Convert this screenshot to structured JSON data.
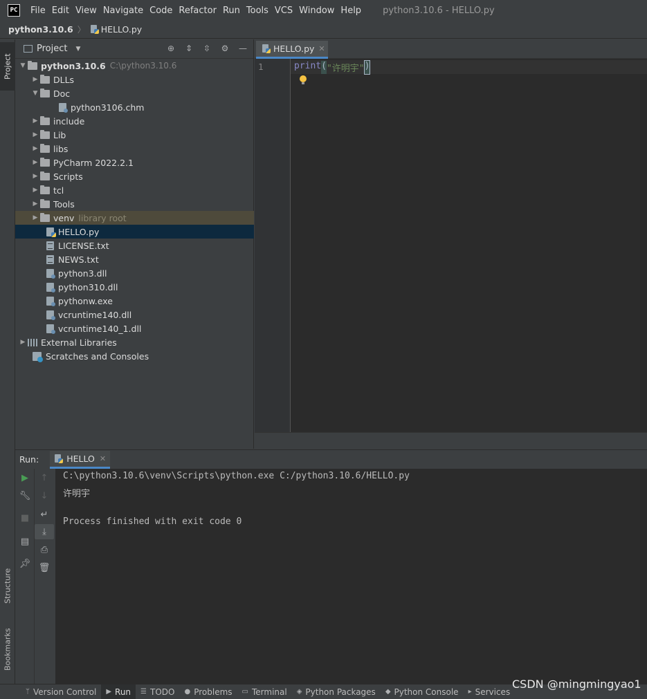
{
  "app": {
    "logo": "PC",
    "menu": [
      "File",
      "Edit",
      "View",
      "Navigate",
      "Code",
      "Refactor",
      "Run",
      "Tools",
      "VCS",
      "Window",
      "Help"
    ],
    "window_title": "python3.10.6 - HELLO.py"
  },
  "breadcrumb": {
    "project": "python3.10.6",
    "file": "HELLO.py"
  },
  "left_stripe": {
    "project": "Project",
    "structure": "Structure",
    "bookmarks": "Bookmarks"
  },
  "project_panel": {
    "title": "Project",
    "tree": [
      {
        "label": "python3.10.6",
        "hint": "C:\\python3.10.6"
      },
      {
        "label": "DLLs"
      },
      {
        "label": "Doc"
      },
      {
        "label": "python3106.chm"
      },
      {
        "label": "include"
      },
      {
        "label": "Lib"
      },
      {
        "label": "libs"
      },
      {
        "label": "PyCharm 2022.2.1"
      },
      {
        "label": "Scripts"
      },
      {
        "label": "tcl"
      },
      {
        "label": "Tools"
      },
      {
        "label": "venv",
        "hint": "library root"
      },
      {
        "label": "HELLO.py"
      },
      {
        "label": "LICENSE.txt"
      },
      {
        "label": "NEWS.txt"
      },
      {
        "label": "python3.dll"
      },
      {
        "label": "python310.dll"
      },
      {
        "label": "pythonw.exe"
      },
      {
        "label": "vcruntime140.dll"
      },
      {
        "label": "vcruntime140_1.dll"
      },
      {
        "label": "External Libraries"
      },
      {
        "label": "Scratches and Consoles"
      }
    ]
  },
  "editor": {
    "tab_label": "HELLO.py",
    "line_number": "1",
    "code_fn": "print",
    "code_open": "(",
    "code_str": "\"许明宇\"",
    "code_close": ")"
  },
  "run": {
    "label": "Run:",
    "tab_label": "HELLO",
    "console": [
      "C:\\python3.10.6\\venv\\Scripts\\python.exe C:/python3.10.6/HELLO.py",
      "许明宇",
      "",
      "Process finished with exit code 0"
    ]
  },
  "bottom_tabs": [
    "Version Control",
    "Run",
    "TODO",
    "Problems",
    "Terminal",
    "Python Packages",
    "Python Console",
    "Services"
  ],
  "watermark": "CSDN @mingmingyao1"
}
